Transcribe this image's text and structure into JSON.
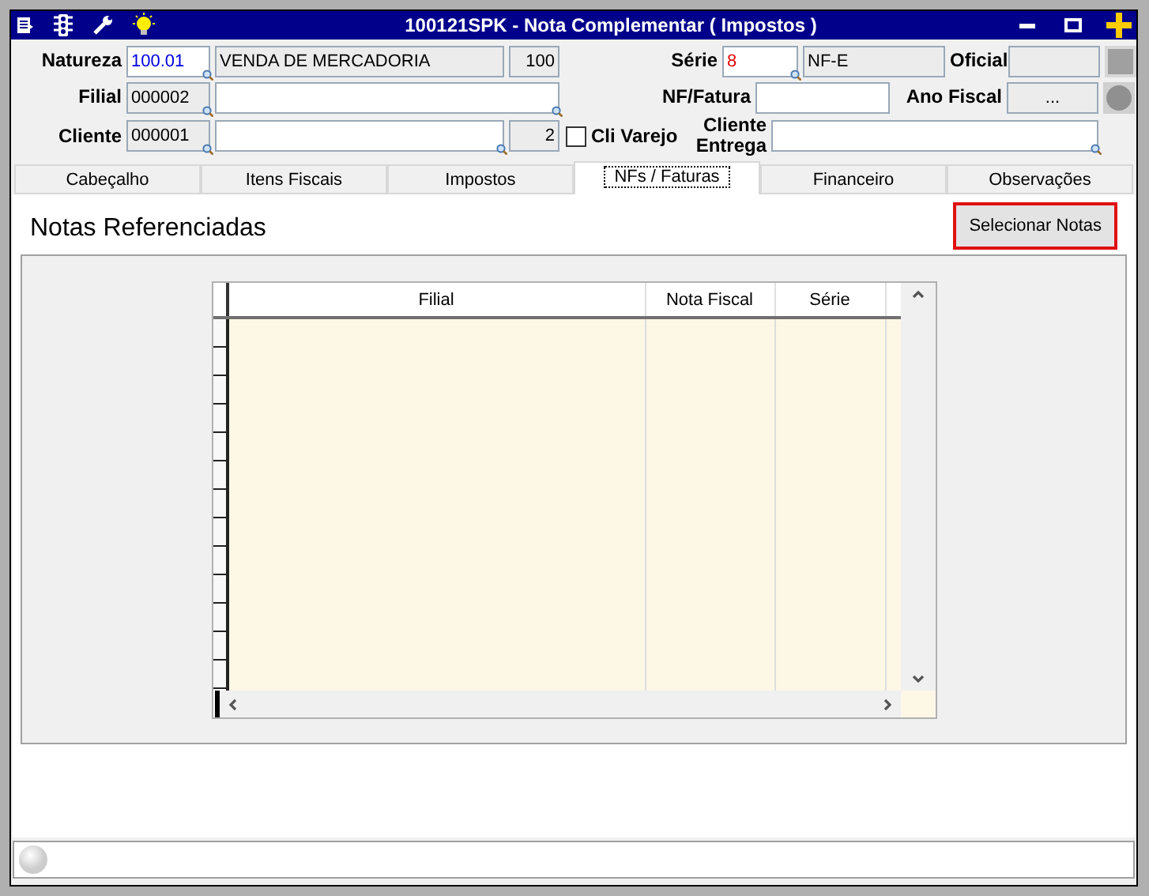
{
  "window": {
    "title": "100121SPK - Nota Complementar ( Impostos )"
  },
  "form": {
    "natureza": {
      "label": "Natureza",
      "code": "100.01",
      "description": "VENDA DE MERCADORIA",
      "number": "100"
    },
    "filial": {
      "label": "Filial",
      "code": "000002"
    },
    "cliente": {
      "label": "Cliente",
      "code": "000001",
      "number": "2"
    },
    "cli_varejo": {
      "label": "Cli Varejo",
      "checked": false
    },
    "serie": {
      "label": "Série",
      "value": "8",
      "description": "NF-E"
    },
    "oficial": {
      "label": "Oficial"
    },
    "nf_fatura": {
      "label": "NF/Fatura"
    },
    "ano_fiscal": {
      "label": "Ano Fiscal",
      "value": "..."
    },
    "cliente_entrega": {
      "label": "Cliente Entrega"
    }
  },
  "tabs": [
    {
      "label": "Cabeçalho",
      "selected": false
    },
    {
      "label": "Itens Fiscais",
      "selected": false
    },
    {
      "label": "Impostos",
      "selected": false
    },
    {
      "label": "NFs / Faturas",
      "selected": true
    },
    {
      "label": "Financeiro",
      "selected": false
    },
    {
      "label": "Observações",
      "selected": false
    }
  ],
  "section": {
    "title": "Notas Referenciadas",
    "button": "Selecionar Notas"
  },
  "table": {
    "columns": [
      "Filial",
      "Nota Fiscal",
      "Série"
    ]
  }
}
